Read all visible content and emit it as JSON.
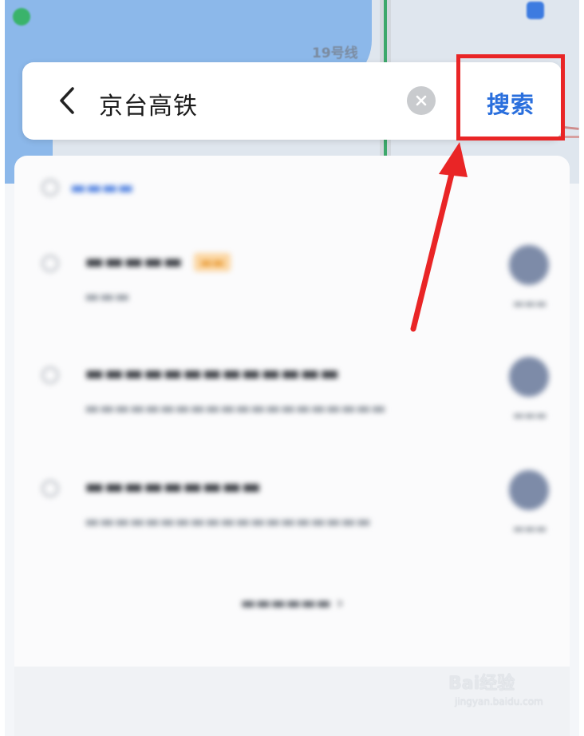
{
  "search": {
    "query": "京台高铁",
    "search_label": "搜索"
  },
  "map": {
    "metro_label": "19号线"
  },
  "watermark": {
    "brand": "Bai经验",
    "url": "jingyan.baidu.com"
  },
  "colors": {
    "accent": "#2a6fdd",
    "highlight": "#e92526",
    "arrow": "#e92526"
  },
  "icons": {
    "back": "chevron-left-icon",
    "clear": "clear-icon",
    "suggestion": "search-icon",
    "navigate": "navigate-icon"
  }
}
